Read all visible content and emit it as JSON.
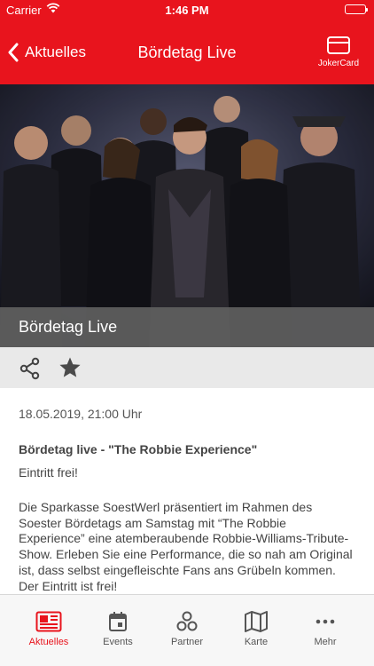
{
  "status_bar": {
    "carrier": "Carrier",
    "time": "1:46 PM"
  },
  "nav": {
    "back_label": "Aktuelles",
    "title": "Bördetag Live",
    "right_label": "JokerCard"
  },
  "hero": {
    "caption": "Bördetag Live"
  },
  "article": {
    "date": "18.05.2019, 21:00 Uhr",
    "heading": "Bördetag live - \"The Robbie Experience\"",
    "intro": "Eintritt frei!",
    "body": "Die Sparkasse SoestWerl präsentiert im Rahmen des Soester Bördetags am Samstag mit “The Robbie Experience” eine atemberaubende Robbie-Williams-Tribute-Show. Erleben Sie eine Performance, die so nah am Original ist, dass selbst eingefleischte Fans ans Grübeln kommen. Der Eintritt ist frei!"
  },
  "tabs": [
    {
      "label": "Aktuelles",
      "icon": "newspaper-icon",
      "active": true
    },
    {
      "label": "Events",
      "icon": "calendar-icon",
      "active": false
    },
    {
      "label": "Partner",
      "icon": "partner-icon",
      "active": false
    },
    {
      "label": "Karte",
      "icon": "map-icon",
      "active": false
    },
    {
      "label": "Mehr",
      "icon": "more-icon",
      "active": false
    }
  ],
  "colors": {
    "accent": "#e8141d",
    "tab_inactive": "#555555",
    "action_bar": "#e9e9e9"
  },
  "icons": [
    "wifi-icon",
    "battery-icon",
    "back-chevron-icon",
    "card-icon",
    "share-icon",
    "star-icon"
  ]
}
